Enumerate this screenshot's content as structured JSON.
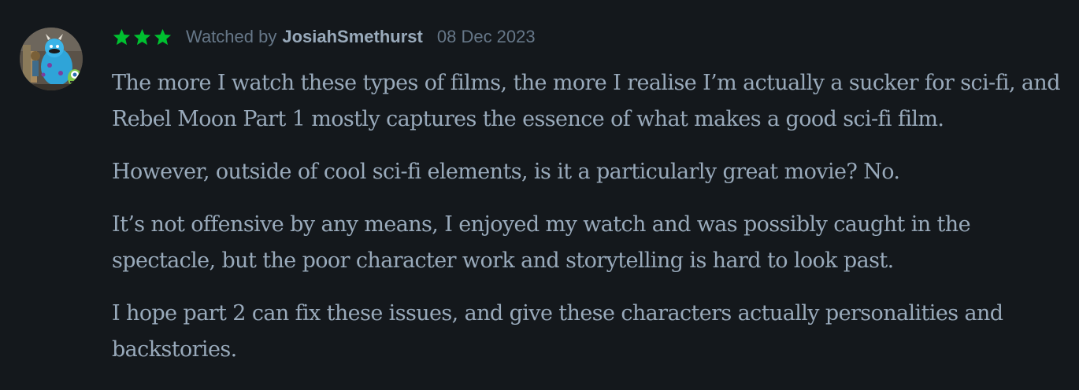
{
  "review": {
    "rating_stars": 3,
    "star_color": "#00c030",
    "watched_prefix": "Watched by",
    "username": "JosiahSmethurst",
    "date": "08 Dec 2023",
    "avatar_icon": "monster-plush-avatar",
    "paragraphs": [
      "The more I watch these types of films, the more I realise I’m actually a sucker for sci-fi, and Rebel Moon Part 1 mostly captures the essence of what makes a good sci-fi film.",
      "However, outside of cool sci-fi elements, is it a particularly great movie? No.",
      "It’s not offensive by any means, I enjoyed my watch and was possibly caught in the spectacle, but the poor character work and storytelling is hard to look past.",
      "I hope part 2 can fix these issues, and give these characters actually personalities and backstories."
    ]
  }
}
